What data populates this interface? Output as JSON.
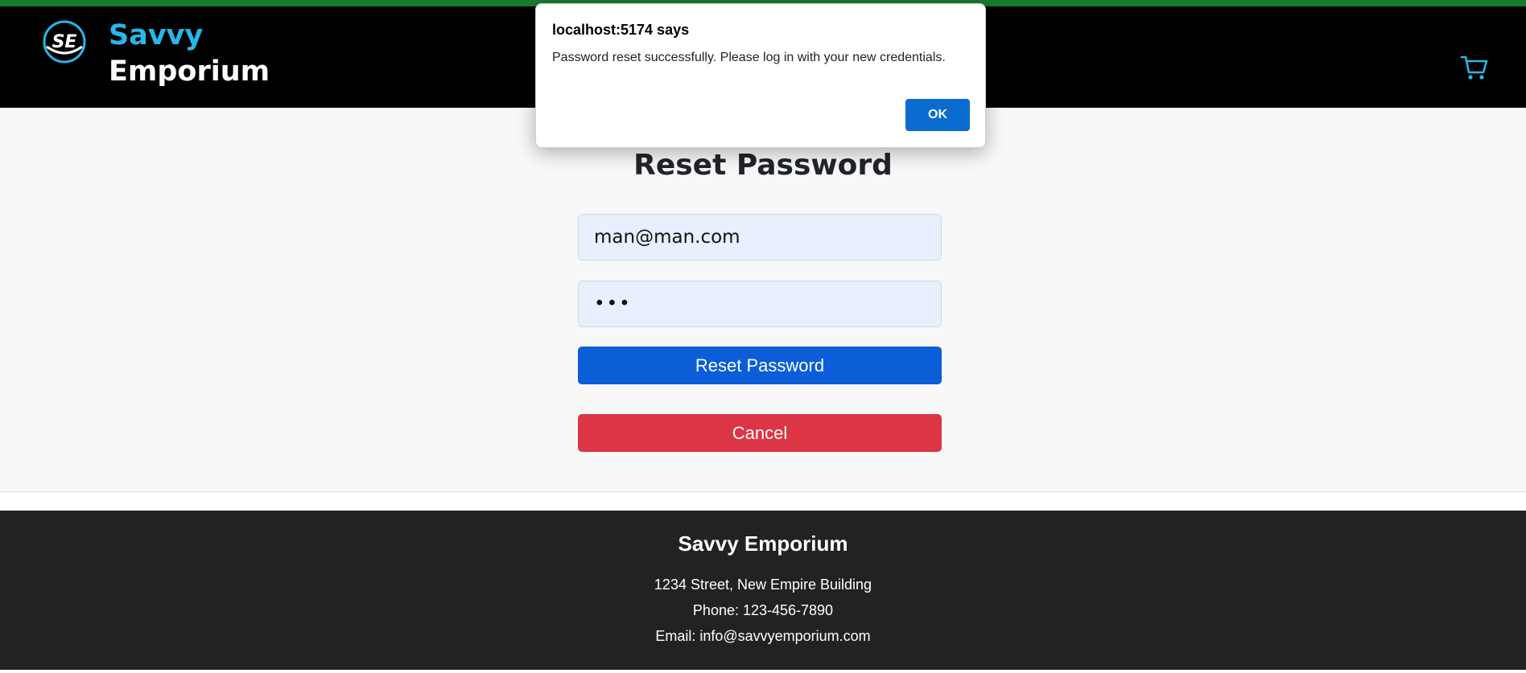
{
  "header": {
    "brand_line1": "Savvy",
    "brand_line2": "Emporium",
    "logo_icon": "se-logo-icon",
    "cart_icon": "shopping-cart-icon"
  },
  "form": {
    "title": "Reset Password",
    "email_value": "man@man.com",
    "password_value": "•••",
    "reset_button": "Reset Password",
    "cancel_button": "Cancel"
  },
  "footer": {
    "title": "Savvy Emporium",
    "address": "1234 Street, New Empire Building",
    "phone": "Phone: 123-456-7890",
    "email": "Email: info@savvyemporium.com"
  },
  "dialog": {
    "title": "localhost:5174 says",
    "message": "Password reset successfully. Please log in with your new credentials.",
    "ok_button": "OK"
  },
  "colors": {
    "brand_accent": "#29b6e8",
    "primary": "#0b5ed7",
    "danger": "#dc3545",
    "dialog_ok": "#0a6cd1"
  }
}
